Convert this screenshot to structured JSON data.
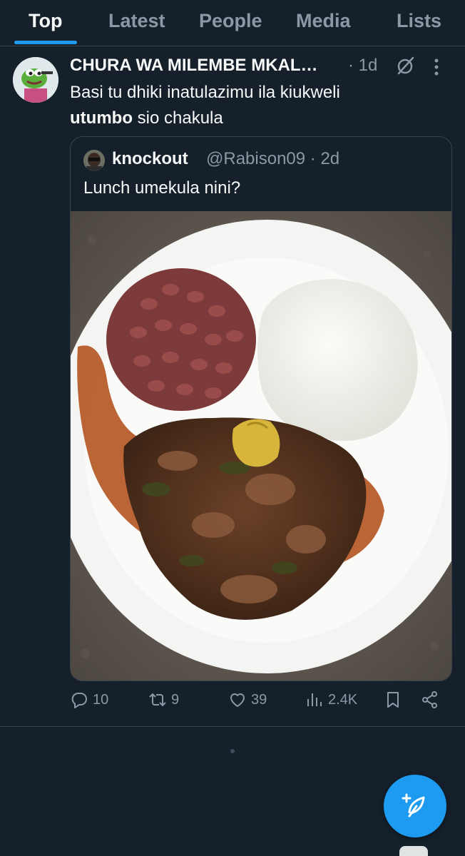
{
  "tabs": [
    {
      "label": "Top",
      "active": true
    },
    {
      "label": "Latest"
    },
    {
      "label": "People"
    },
    {
      "label": "Media"
    },
    {
      "label": "Lists"
    }
  ],
  "tweet": {
    "author_name": "CHURA WA MILEMBE MKAL…",
    "meta": "· 1d",
    "text_line1": "Basi tu dhiki inatulazimu  ila kiukweli",
    "text_bold": "utumbo",
    "text_rest": " sio chakula",
    "quote": {
      "name": "knockout",
      "handle_time": "@Rabison09 · 2d",
      "text": "Lunch umekula nini?"
    },
    "actions": {
      "replies": "10",
      "reposts": "9",
      "likes": "39",
      "views": "2.4K"
    }
  },
  "icons": {
    "reply": "reply-icon",
    "repost": "repost-icon",
    "like": "like-icon",
    "views": "views-icon",
    "bookmark": "bookmark-icon",
    "share": "share-icon",
    "compose": "compose-icon",
    "grok": "grok-icon",
    "more": "more-icon"
  },
  "colors": {
    "background": "#15202b",
    "accent": "#1d9bf0",
    "secondary_text": "#8b98a5",
    "border": "#38444d"
  }
}
